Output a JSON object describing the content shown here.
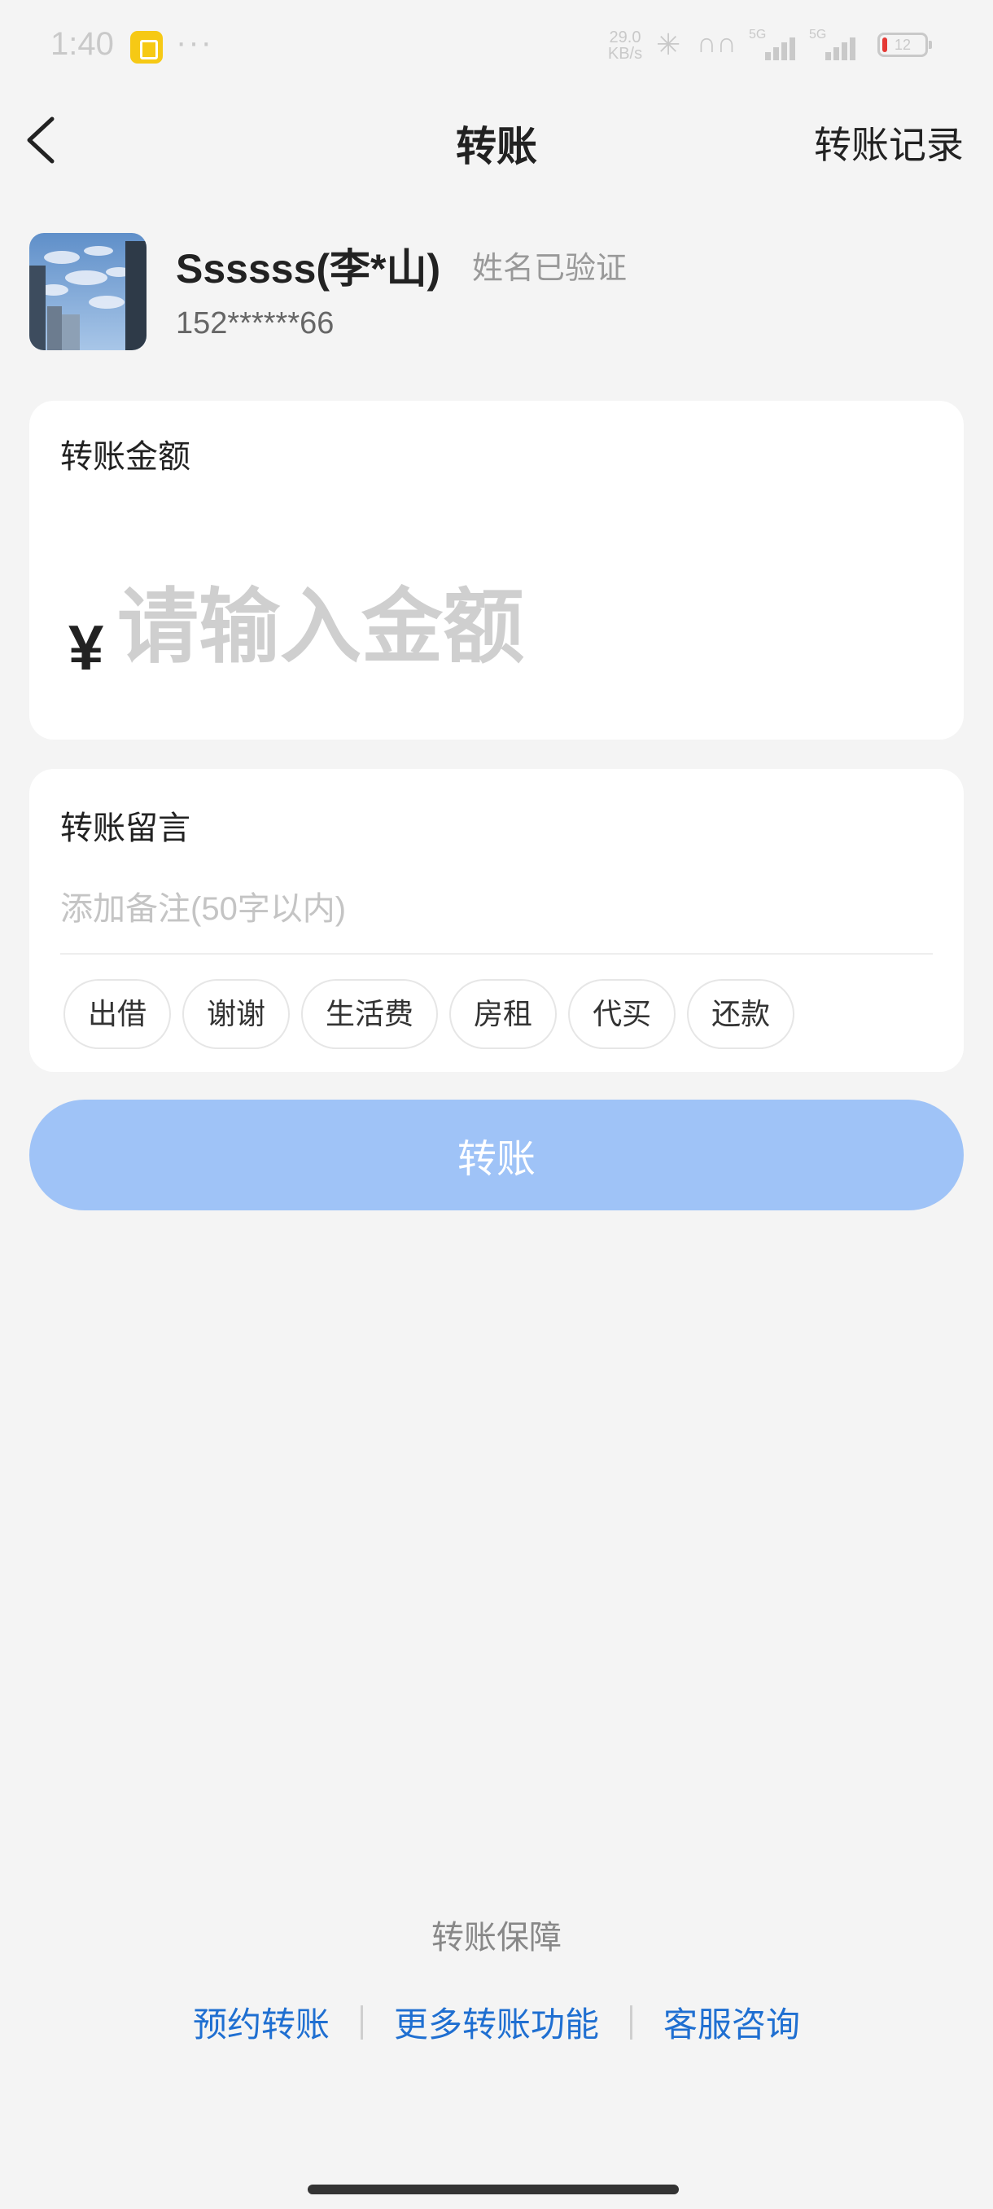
{
  "status_bar": {
    "time": "1:40",
    "dots": "···",
    "network_speed": "29.0 KB/s",
    "signal_1_tag": "5G",
    "signal_2_tag": "5G",
    "battery_level": "12",
    "battery_fraction": 0.12
  },
  "nav": {
    "title": "转账",
    "records_link": "转账记录"
  },
  "payee": {
    "name": "Ssssss(李*山)",
    "verified": "姓名已验证",
    "phone": "152******66"
  },
  "amount": {
    "label": "转账金额",
    "currency": "¥",
    "placeholder": "请输入金额",
    "value": ""
  },
  "memo": {
    "label": "转账留言",
    "placeholder": "添加备注(50字以内)",
    "value": "",
    "chips": [
      "出借",
      "谢谢",
      "生活费",
      "房租",
      "代买",
      "还款"
    ]
  },
  "transfer_button": "转账",
  "footer": {
    "guarantee": "转账保障",
    "links": [
      "预约转账",
      "更多转账功能",
      "客服咨询"
    ]
  },
  "colors": {
    "page_background": "#f4f4f4",
    "card_background": "#ffffff",
    "button_disabled": "#9fc3f7",
    "link_blue": "#1f6fd1",
    "battery_low": "#e53935"
  }
}
